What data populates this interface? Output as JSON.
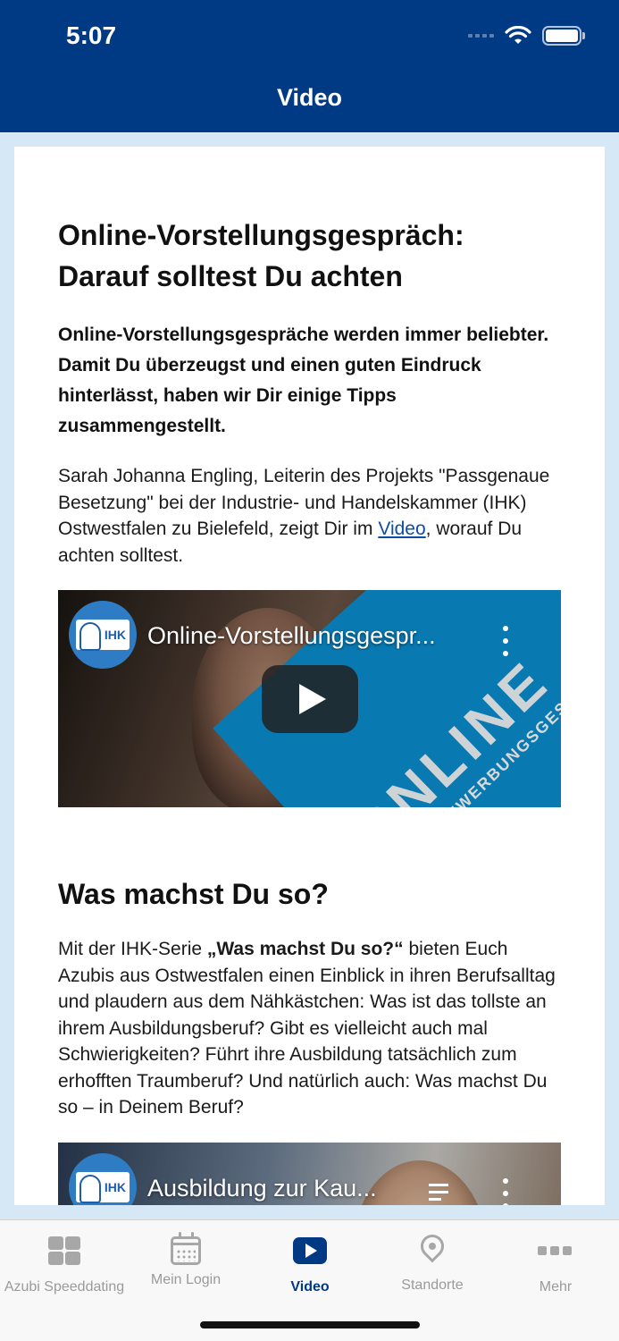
{
  "status_bar": {
    "time": "5:07"
  },
  "nav": {
    "title": "Video"
  },
  "article": {
    "heading_line1": "Online-Vorstellungsgespräch:",
    "heading_line2": "Darauf solltest Du achten",
    "lead": "Online-Vorstellungsgespräche werden immer beliebter. Damit Du überzeugst und einen guten Eindruck hinterlässt, haben wir Dir einige Tipps zusammengestellt.",
    "para_before_link": "Sarah Johanna Engling, Leiterin des Projekts \"Passgenaue Besetzung\" bei der Industrie- und Handelskammer (IHK) Ostwestfalen zu Bielefeld, zeigt Dir im ",
    "para_link": "Video",
    "para_after_link": ", worauf Du achten solltest.",
    "video1": {
      "channel_logo": "IHK",
      "title": "Online-Vorstellungsgespr...",
      "thumb_text": "ONLINE",
      "thumb_sub": "BEWERBUNGSGESPRÄCH"
    },
    "heading2": "Was machst Du so?",
    "para2_before_bold": "Mit der IHK-Serie ",
    "para2_bold": "„Was machst Du so?“",
    "para2_after_bold": " bieten Euch Azubis aus Ostwestfalen einen Einblick in ihren Berufsalltag und plaudern aus dem Nähkästchen: Was ist das tollste an ihrem Ausbildungsberuf? Gibt es vielleicht auch mal Schwierigkeiten? Führt ihre Ausbildung tatsächlich zum erhofften Traumberuf? Und natürlich auch: Was machst Du so – in Deinem Beruf?",
    "video2": {
      "channel_logo": "IHK",
      "title": "Ausbildung zur Kau..."
    }
  },
  "tabbar": {
    "tabs": [
      {
        "label": "Azubi Speeddating",
        "icon": "grid-icon"
      },
      {
        "label": "Mein Login",
        "icon": "calendar-icon"
      },
      {
        "label": "Video",
        "icon": "play-icon",
        "active": true
      },
      {
        "label": "Standorte",
        "icon": "location-pin-icon"
      },
      {
        "label": "Mehr",
        "icon": "more-icon"
      }
    ]
  },
  "colors": {
    "primary": "#003a85",
    "background": "#d6e8f6",
    "link": "#0c4ea3",
    "tab_inactive": "#9a9a9a"
  }
}
